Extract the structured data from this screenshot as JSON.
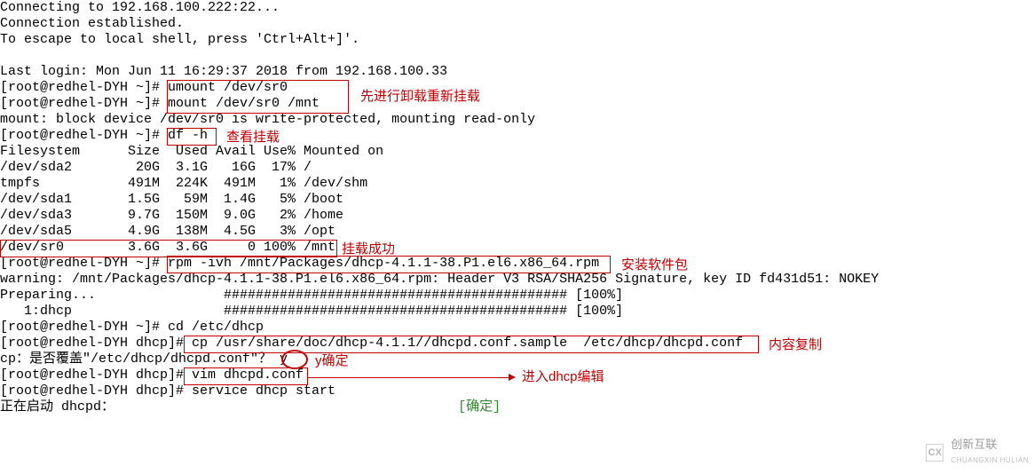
{
  "terminal": {
    "connecting": "Connecting to 192.168.100.222:22...",
    "connection_established": "Connection established.",
    "escape_hint": "To escape to local shell, press 'Ctrl+Alt+]'.",
    "blank": "",
    "last_login": "Last login: Mon Jun 11 16:29:37 2018 from 192.168.100.33",
    "prompt1": "[root@redhel-DYH ~]# umount /dev/sr0",
    "prompt2": "[root@redhel-DYH ~]# mount /dev/sr0 /mnt",
    "mount_msg": "mount: block device /dev/sr0 is write-protected, mounting read-only",
    "prompt3": "[root@redhel-DYH ~]# df -h",
    "df_header": "Filesystem      Size  Used Avail Use% Mounted on",
    "df_row1": "/dev/sda2        20G  3.1G   16G  17% /",
    "df_row2": "tmpfs           491M  224K  491M   1% /dev/shm",
    "df_row3": "/dev/sda1       1.5G   59M  1.4G   5% /boot",
    "df_row4": "/dev/sda3       9.7G  150M  9.0G   2% /home",
    "df_row5": "/dev/sda5       4.9G  138M  4.5G   3% /opt",
    "df_row6": "/dev/sr0        3.6G  3.6G     0 100% /mnt",
    "prompt4": "[root@redhel-DYH ~]# rpm -ivh /mnt/Packages/dhcp-4.1.1-38.P1.el6.x86_64.rpm",
    "warning": "warning: /mnt/Packages/dhcp-4.1.1-38.P1.el6.x86_64.rpm: Header V3 RSA/SHA256 Signature, key ID fd431d51: NOKEY",
    "preparing": "Preparing...                ########################################### [100%]",
    "pkg1": "   1:dhcp                   ########################################### [100%]",
    "prompt5": "[root@redhel-DYH ~]# cd /etc/dhcp",
    "prompt6": "[root@redhel-DYH dhcp]# cp /usr/share/doc/dhcp-4.1.1//dhcpd.conf.sample  /etc/dhcp/dhcpd.conf",
    "cp_confirm": "cp：是否覆盖\"/etc/dhcp/dhcpd.conf\"？ y",
    "prompt7": "[root@redhel-DYH dhcp]# vim dhcpd.conf",
    "prompt8": "[root@redhel-DYH dhcp]# service dhcp start",
    "starting_label": "正在启动 dhcpd：",
    "starting_ok": "[确定]"
  },
  "annotations": {
    "a1": "先进行卸载重新挂载",
    "a2": "查看挂载",
    "a3": "挂载成功",
    "a4": "安装软件包",
    "a5": "内容复制",
    "a6": "y确定",
    "a7": "进入dhcp编辑"
  },
  "watermark": {
    "text": "创新互联",
    "sub": "CHUANGXIN HULIAN"
  }
}
